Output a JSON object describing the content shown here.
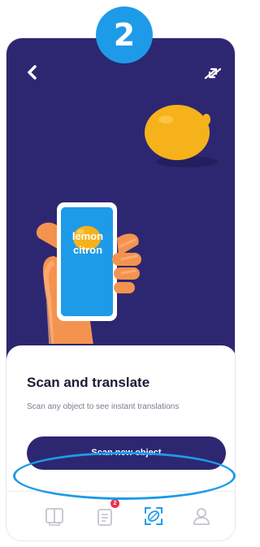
{
  "step_badge": "2",
  "header": {
    "back_icon": "chevron-left-icon",
    "swap_icon": "swap-arrows-icon"
  },
  "illustration": {
    "word_1": "lemon",
    "word_2": "citron"
  },
  "sheet": {
    "title": "Scan and translate",
    "subtitle": "Scan any object to see instant translations",
    "button_label": "Scan new object"
  },
  "tabbar": {
    "tabs": [
      {
        "icon": "book-icon",
        "active": false
      },
      {
        "icon": "flashcards-icon",
        "active": false,
        "badge": "2"
      },
      {
        "icon": "scan-icon",
        "active": true
      },
      {
        "icon": "profile-icon",
        "active": false
      }
    ]
  },
  "colors": {
    "primary": "#2d2772",
    "accent": "#1e9be8",
    "lemon": "#f6b21b",
    "skin": "#f4934f",
    "badge_red": "#e8334a"
  }
}
